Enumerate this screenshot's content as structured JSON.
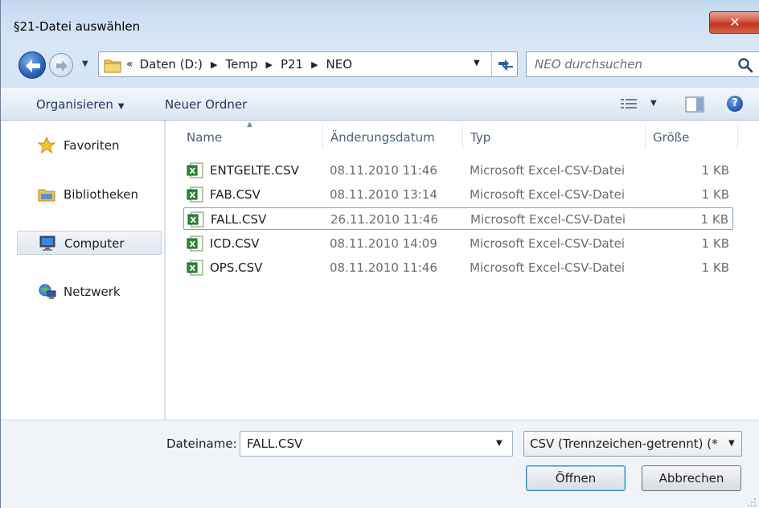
{
  "window": {
    "title": "§21-Datei auswählen",
    "close_glyph": "✕",
    "close_bg": "#c1361d"
  },
  "address": {
    "prefix": "«",
    "crumbs": [
      "Daten (D:)",
      "Temp",
      "P21",
      "NEO"
    ],
    "search_placeholder": "NEO durchsuchen"
  },
  "toolbar": {
    "organize_label": "Organisieren",
    "new_folder_label": "Neuer Ordner",
    "help_glyph": "?"
  },
  "sidebar": {
    "items": [
      {
        "label": "Favoriten",
        "icon": "star-icon"
      },
      {
        "label": "Bibliotheken",
        "icon": "libraries-icon"
      },
      {
        "label": "Computer",
        "icon": "computer-icon",
        "selected": true
      },
      {
        "label": "Netzwerk",
        "icon": "network-icon"
      }
    ]
  },
  "filelist": {
    "columns": {
      "name": "Name",
      "date": "Änderungsdatum",
      "type": "Typ",
      "size": "Größe"
    },
    "rows": [
      {
        "name": "ENTGELTE.CSV",
        "date": "08.11.2010 11:46",
        "type": "Microsoft Excel-CSV-Datei",
        "size": "1 KB"
      },
      {
        "name": "FAB.CSV",
        "date": "08.11.2010 13:14",
        "type": "Microsoft Excel-CSV-Datei",
        "size": "1 KB"
      },
      {
        "name": "FALL.CSV",
        "date": "26.11.2010 11:46",
        "type": "Microsoft Excel-CSV-Datei",
        "size": "1 KB",
        "selected": true
      },
      {
        "name": "ICD.CSV",
        "date": "08.11.2010 14:09",
        "type": "Microsoft Excel-CSV-Datei",
        "size": "1 KB"
      },
      {
        "name": "OPS.CSV",
        "date": "08.11.2010 11:46",
        "type": "Microsoft Excel-CSV-Datei",
        "size": "1 KB"
      }
    ]
  },
  "bottom": {
    "filename_label": "Dateiname:",
    "filename_value": "FALL.CSV",
    "filter_value": "CSV (Trennzeichen-getrennt) (*",
    "open_label": "Öffnen",
    "cancel_label": "Abbrechen"
  },
  "colors": {
    "accent": "#2b62b8",
    "selection_border": "#7da2ce"
  }
}
